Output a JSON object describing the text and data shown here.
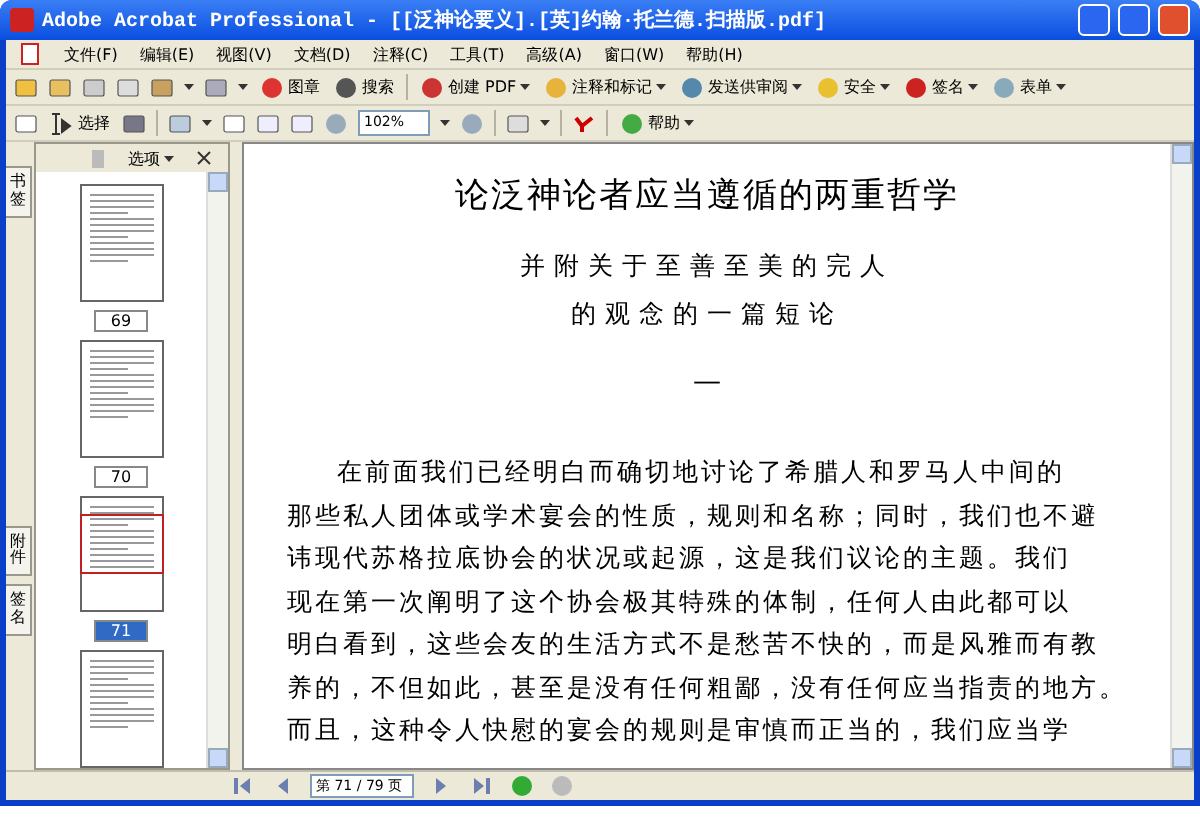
{
  "window": {
    "title": "Adobe Acrobat Professional - [[泛神论要义].[英]约翰·托兰德.扫描版.pdf]"
  },
  "menu": [
    {
      "label": "文件(F)"
    },
    {
      "label": "编辑(E)"
    },
    {
      "label": "视图(V)"
    },
    {
      "label": "文档(D)"
    },
    {
      "label": "注释(C)"
    },
    {
      "label": "工具(T)"
    },
    {
      "label": "高级(A)"
    },
    {
      "label": "窗口(W)"
    },
    {
      "label": "帮助(H)"
    }
  ],
  "toolbar_1": [
    {
      "label": "图章",
      "dropdown": false
    },
    {
      "label": "搜索",
      "dropdown": false
    },
    {
      "label": "创建 PDF",
      "dropdown": true
    },
    {
      "label": "注释和标记",
      "dropdown": true
    },
    {
      "label": "发送供审阅",
      "dropdown": true
    },
    {
      "label": "安全",
      "dropdown": true
    },
    {
      "label": "签名",
      "dropdown": true
    },
    {
      "label": "表单",
      "dropdown": true
    }
  ],
  "toolbar_2": {
    "select_label": "选择",
    "zoom_value": "102%",
    "help_label": "帮助"
  },
  "side_tabs": [
    {
      "label": "书签"
    },
    {
      "label": "附件"
    },
    {
      "label": "签名"
    }
  ],
  "panel": {
    "options_label": "选项"
  },
  "thumbnails": [
    {
      "label": "69",
      "selected": false
    },
    {
      "label": "70",
      "selected": false
    },
    {
      "label": "71",
      "selected": true
    },
    {
      "selected": false
    }
  ],
  "page": {
    "title": "论泛神论者应当遵循的两重哲学",
    "subtitle": [
      "并附关于至善至美的完人",
      "的观念的一篇短论"
    ],
    "dash": "—",
    "paragraph": [
      "在前面我们已经明白而确切地讨论了希腊人和罗马人中间的",
      "那些私人团体或学术宴会的性质，规则和名称；同时，我们也不避",
      "讳现代苏格拉底协会的状况或起源，这是我们议论的主题。我们",
      "现在第一次阐明了这个协会极其特殊的体制，任何人由此都可以",
      "明白看到，这些会友的生活方式不是愁苦不快的，而是风雅而有教",
      "养的，不但如此，甚至是没有任何粗鄙，没有任何应当指责的地方。",
      "而且，这种令人快慰的宴会的规则是审慎而正当的，我们应当学"
    ]
  },
  "status_bar": {
    "page_field": "第 71 / 79 页"
  }
}
